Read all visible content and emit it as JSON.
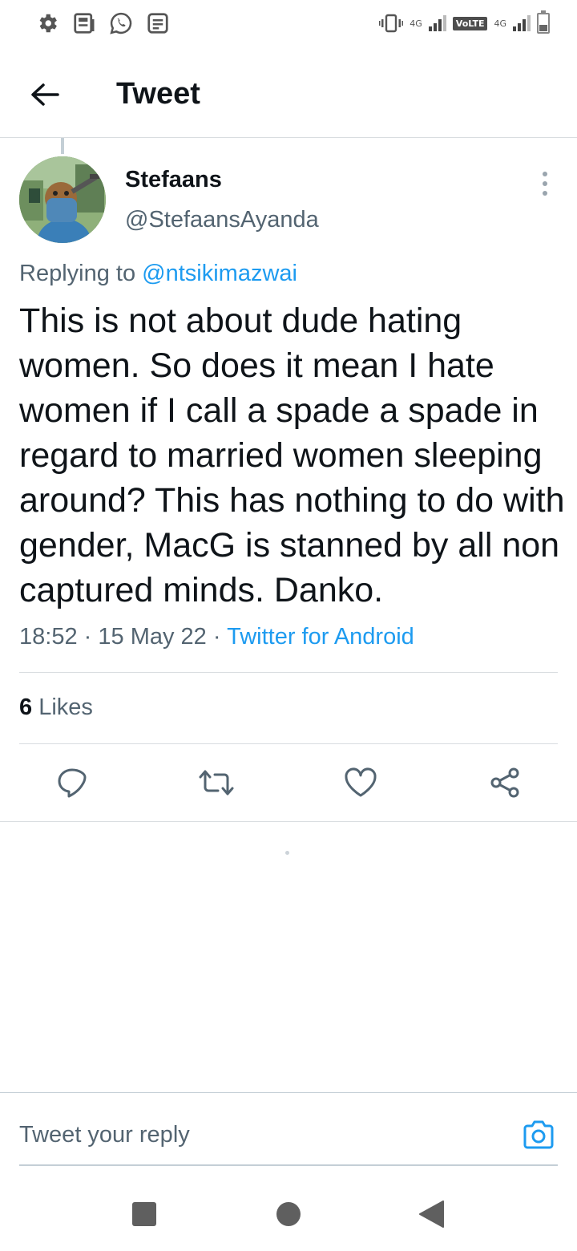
{
  "status_bar": {
    "left_icons": [
      "gear-icon",
      "news-icon",
      "whatsapp-icon",
      "notes-icon"
    ],
    "network_1": "4G",
    "volte": "VoLTE",
    "network_2": "4G"
  },
  "header": {
    "title": "Tweet"
  },
  "tweet": {
    "display_name": "Stefaans",
    "handle": "@StefaansAyanda",
    "replying_prefix": "Replying to",
    "replying_to": "@ntsikimazwai",
    "text": "This is not about dude hating women. So does it mean I hate women if I call a spade a spade in regard to married women sleeping around? This has nothing to do with gender, MacG is stanned by all non captured minds. Danko.",
    "time": "18:52",
    "date": "15 May 22",
    "source": "Twitter for Android",
    "likes_count": "6",
    "likes_label": "Likes"
  },
  "reply": {
    "placeholder": "Tweet your reply"
  },
  "colors": {
    "accent": "#1d9bf0",
    "text_primary": "#0f1419",
    "text_secondary": "#536471",
    "divider": "#d9dde0"
  }
}
